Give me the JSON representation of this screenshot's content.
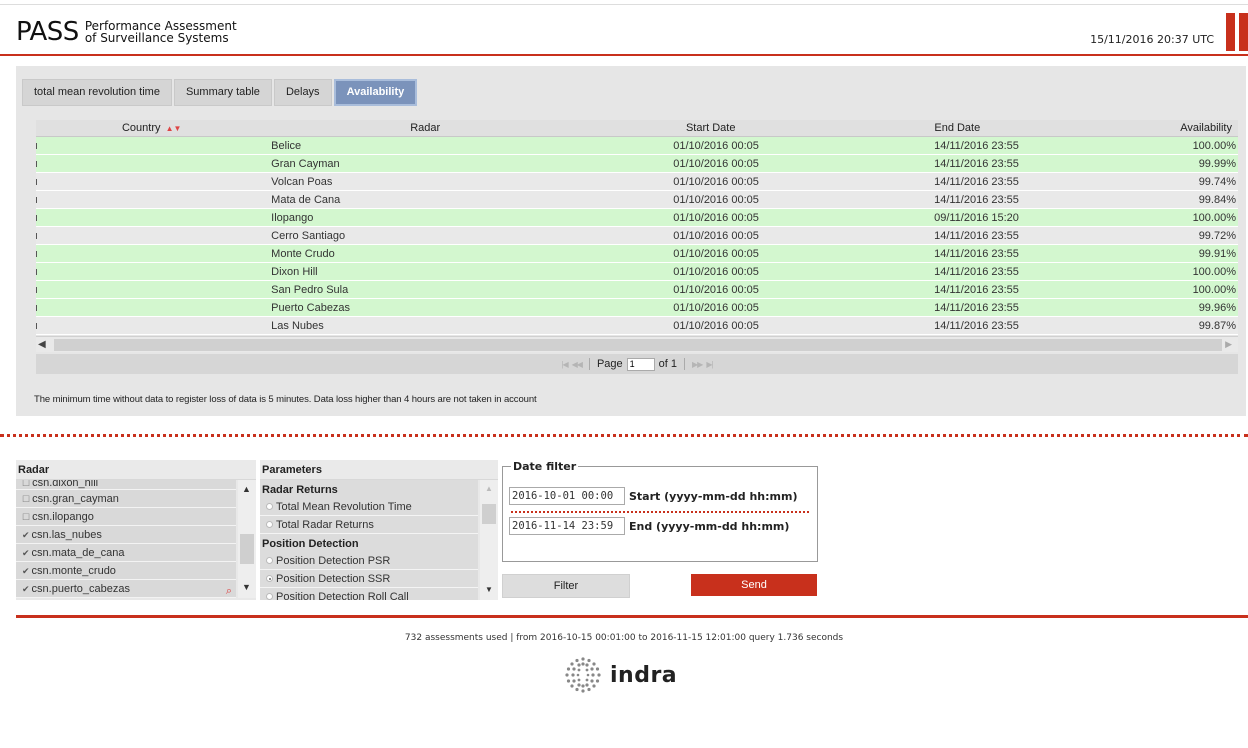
{
  "header": {
    "logo_big": "PASS",
    "logo_line1": "Performance Assessment",
    "logo_line2": "of Surveillance Systems",
    "datetime": "15/11/2016 20:37 UTC"
  },
  "tabs": [
    {
      "label": "total mean revolution time",
      "active": false
    },
    {
      "label": "Summary table",
      "active": false
    },
    {
      "label": "Delays",
      "active": false
    },
    {
      "label": "Availability",
      "active": true
    }
  ],
  "table": {
    "headers": {
      "country": "Country",
      "radar": "Radar",
      "start": "Start Date",
      "end": "End Date",
      "availability": "Availability"
    },
    "rows": [
      {
        "radar": "Belice",
        "start": "01/10/2016 00:05",
        "end": "14/11/2016 23:55",
        "availability": "100.00%",
        "status": "ok"
      },
      {
        "radar": "Gran Cayman",
        "start": "01/10/2016 00:05",
        "end": "14/11/2016 23:55",
        "availability": "99.99%",
        "status": "ok"
      },
      {
        "radar": "Volcan Poas",
        "start": "01/10/2016 00:05",
        "end": "14/11/2016 23:55",
        "availability": "99.74%",
        "status": "warn"
      },
      {
        "radar": "Mata de Cana",
        "start": "01/10/2016 00:05",
        "end": "14/11/2016 23:55",
        "availability": "99.84%",
        "status": "warn"
      },
      {
        "radar": "Ilopango",
        "start": "01/10/2016 00:05",
        "end": "09/11/2016 15:20",
        "availability": "100.00%",
        "status": "ok"
      },
      {
        "radar": "Cerro Santiago",
        "start": "01/10/2016 00:05",
        "end": "14/11/2016 23:55",
        "availability": "99.72%",
        "status": "warn"
      },
      {
        "radar": "Monte Crudo",
        "start": "01/10/2016 00:05",
        "end": "14/11/2016 23:55",
        "availability": "99.91%",
        "status": "ok"
      },
      {
        "radar": "Dixon Hill",
        "start": "01/10/2016 00:05",
        "end": "14/11/2016 23:55",
        "availability": "100.00%",
        "status": "ok"
      },
      {
        "radar": "San Pedro Sula",
        "start": "01/10/2016 00:05",
        "end": "14/11/2016 23:55",
        "availability": "100.00%",
        "status": "ok"
      },
      {
        "radar": "Puerto Cabezas",
        "start": "01/10/2016 00:05",
        "end": "14/11/2016 23:55",
        "availability": "99.96%",
        "status": "ok"
      },
      {
        "radar": "Las Nubes",
        "start": "01/10/2016 00:05",
        "end": "14/11/2016 23:55",
        "availability": "99.87%",
        "status": "warn"
      }
    ]
  },
  "pager": {
    "page_label": "Page",
    "page_value": "1",
    "of_label": "of 1"
  },
  "note": "The minimum time without data to register loss of data is 5 minutes. Data loss higher than 4 hours are not taken in account",
  "radar_panel": {
    "title": "Radar",
    "items": [
      {
        "label": "csn.dixon_hill",
        "checked": false
      },
      {
        "label": "csn.gran_cayman",
        "checked": false
      },
      {
        "label": "csn.ilopango",
        "checked": false
      },
      {
        "label": "csn.las_nubes",
        "checked": true
      },
      {
        "label": "csn.mata_de_cana",
        "checked": true
      },
      {
        "label": "csn.monte_crudo",
        "checked": true
      },
      {
        "label": "csn.puerto_cabezas",
        "checked": true
      }
    ]
  },
  "param_panel": {
    "title": "Parameters",
    "group1": "Radar Returns",
    "item1": "Total Mean Revolution Time",
    "item2": "Total Radar Returns",
    "group2": "Position Detection",
    "item3": "Position Detection PSR",
    "item4": "Position Detection SSR",
    "item5": "Position Detection Roll Call"
  },
  "date_filter": {
    "legend": "Date filter",
    "start_value": "2016-10-01 00:00",
    "start_label": "Start (yyyy-mm-dd hh:mm)",
    "end_value": "2016-11-14 23:59",
    "end_label": "End (yyyy-mm-dd hh:mm)"
  },
  "buttons": {
    "filter": "Filter",
    "send": "Send"
  },
  "footer": {
    "stats": "732 assessments used | from 2016-10-15 00:01:00 to 2016-11-15 12:01:00 query 1.736 seconds",
    "brand": "indra"
  },
  "colors": {
    "accent_red": "#c8301c",
    "row_ok": "#d3f7cf",
    "row_warn": "#e9e9e9",
    "tab_active": "#7b93bb"
  }
}
